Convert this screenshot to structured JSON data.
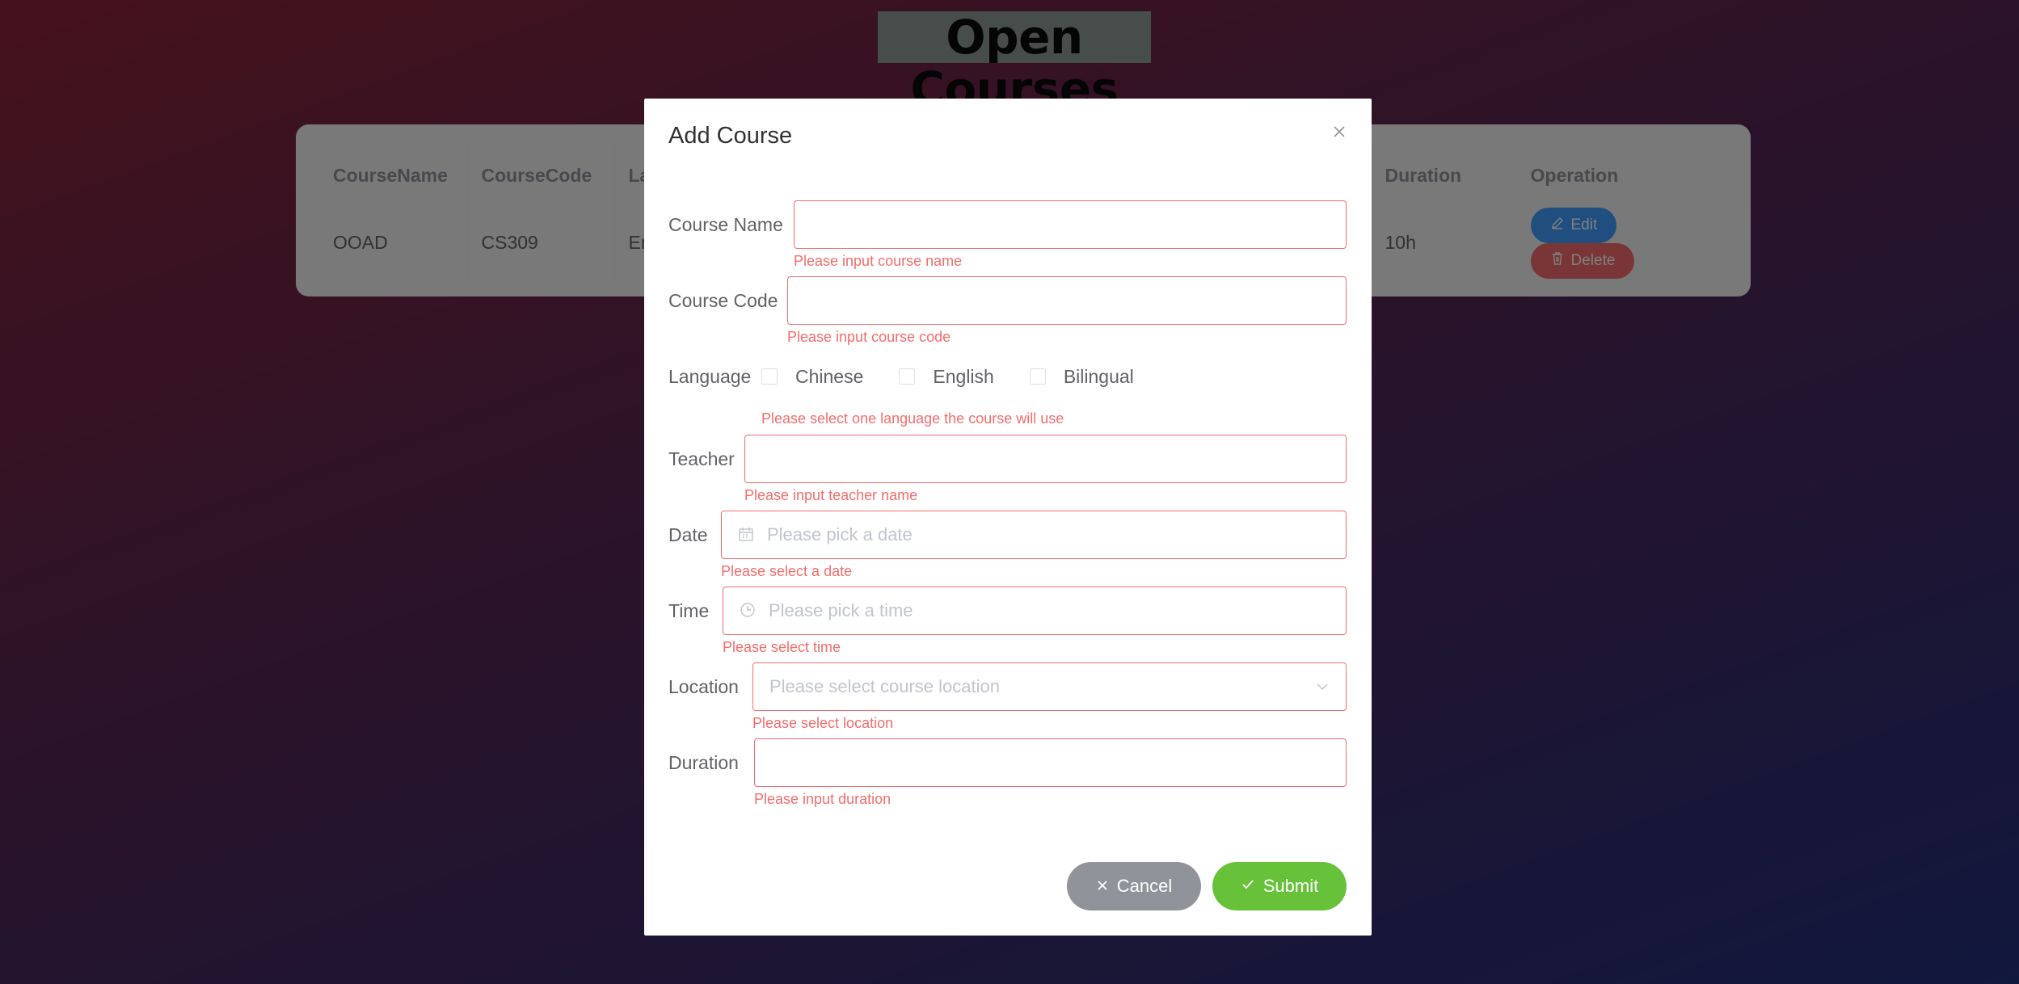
{
  "page": {
    "title": "Open Courses"
  },
  "table": {
    "columns": [
      "CourseName",
      "CourseCode",
      "La",
      "Duration",
      "Operation"
    ],
    "rows": [
      {
        "course_name": "OOAD",
        "course_code": "CS309",
        "language": "En",
        "duration": "10h"
      }
    ],
    "edit_label": "Edit",
    "delete_label": "Delete"
  },
  "dialog": {
    "title": "Add Course",
    "fields": {
      "course_name": {
        "label": "Course Name",
        "error": "Please input course name",
        "value": ""
      },
      "course_code": {
        "label": "Course Code",
        "error": "Please input course code",
        "value": ""
      },
      "language": {
        "label": "Language",
        "options": [
          "Chinese",
          "English",
          "Bilingual"
        ],
        "error": "Please select one language the course will use"
      },
      "teacher": {
        "label": "Teacher",
        "error": "Please input teacher name",
        "value": ""
      },
      "date": {
        "label": "Date",
        "placeholder": "Please pick a date",
        "error": "Please select a date"
      },
      "time": {
        "label": "Time",
        "placeholder": "Please pick a time",
        "error": "Please select time"
      },
      "location": {
        "label": "Location",
        "placeholder": "Please select course location",
        "error": "Please select location"
      },
      "duration": {
        "label": "Duration",
        "error": "Please input duration",
        "value": ""
      }
    },
    "cancel_label": "Cancel",
    "submit_label": "Submit"
  },
  "colors": {
    "error": "#f56c6c",
    "primary": "#409eff",
    "success": "#67c23a",
    "info": "#909399"
  },
  "icons": {
    "edit": "edit-icon",
    "delete": "delete-icon",
    "close": "close-icon",
    "calendar": "calendar-icon",
    "clock": "clock-icon",
    "chevron": "chevron-down-icon",
    "cancel": "close-icon",
    "submit": "check-icon"
  }
}
